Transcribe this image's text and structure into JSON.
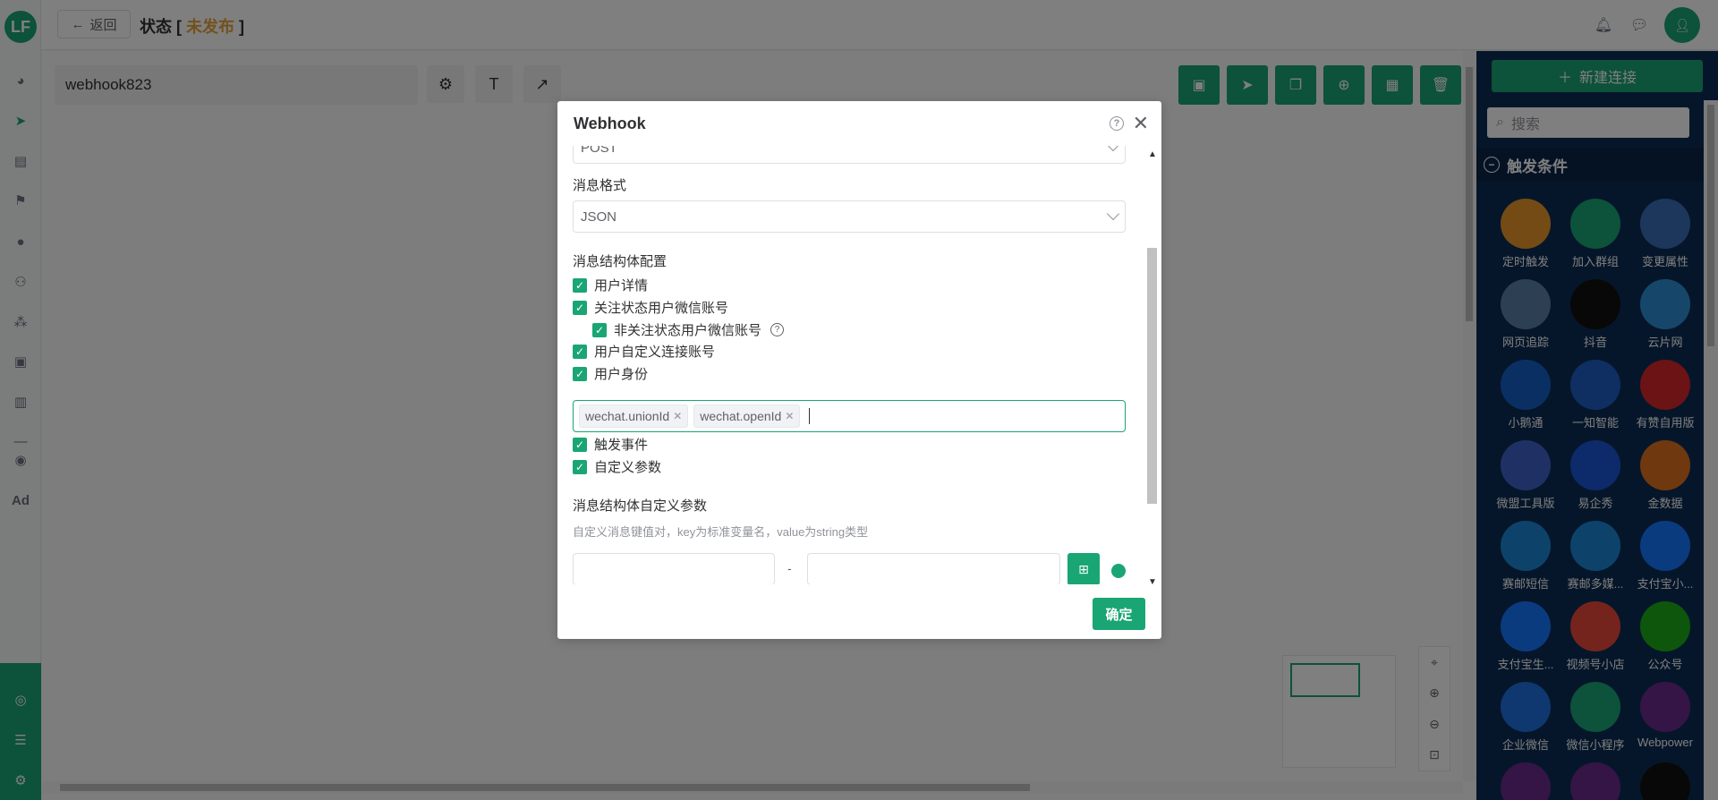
{
  "topbar": {
    "back_label": "返回",
    "status_prefix": "状态 [ ",
    "status_value": "未发布",
    "status_suffix": " ]"
  },
  "canvas": {
    "flow_name": "webhook823"
  },
  "right_panel": {
    "new_connection_label": "新建连接",
    "search_placeholder": "搜索",
    "section_title": "触发条件",
    "apps": [
      {
        "label": "定时触发",
        "color": "#e8962a"
      },
      {
        "label": "加入群组",
        "color": "#1aa574"
      },
      {
        "label": "变更属性",
        "color": "#3a6fb8"
      },
      {
        "label": "网页追踪",
        "color": "#5b7fa6"
      },
      {
        "label": "抖音",
        "color": "#111111"
      },
      {
        "label": "云片网",
        "color": "#2d8fd5"
      },
      {
        "label": "小鹅通",
        "color": "#1560c7"
      },
      {
        "label": "一知智能",
        "color": "#1f5cc4"
      },
      {
        "label": "有赞自用版",
        "color": "#d7262a"
      },
      {
        "label": "微盟工具版",
        "color": "#3e63c9"
      },
      {
        "label": "易企秀",
        "color": "#1a55d6"
      },
      {
        "label": "金数据",
        "color": "#e0701e"
      },
      {
        "label": "赛邮短信",
        "color": "#1b87d6"
      },
      {
        "label": "赛邮多媒...",
        "color": "#1b87d6"
      },
      {
        "label": "支付宝小...",
        "color": "#1677ff"
      },
      {
        "label": "支付宝生...",
        "color": "#1677ff"
      },
      {
        "label": "视频号小店",
        "color": "#e8493a"
      },
      {
        "label": "公众号",
        "color": "#1aad19"
      },
      {
        "label": "企业微信",
        "color": "#1f6fe0"
      },
      {
        "label": "微信小程序",
        "color": "#1aa574"
      },
      {
        "label": "Webpower",
        "color": "#6a2b8c"
      },
      {
        "label": "",
        "color": "#6a2b8c"
      },
      {
        "label": "",
        "color": "#6a2b8c"
      },
      {
        "label": "",
        "color": "#111111"
      }
    ]
  },
  "modal": {
    "title": "Webhook",
    "method_value": "POST",
    "format_label": "消息格式",
    "format_value": "JSON",
    "struct_label": "消息结构体配置",
    "checkboxes": {
      "user_detail": "用户详情",
      "follow_wechat": "关注状态用户微信账号",
      "unfollow_wechat": "非关注状态用户微信账号",
      "custom_account": "用户自定义连接账号",
      "user_identity": "用户身份",
      "trigger_event": "触发事件",
      "custom_params": "自定义参数"
    },
    "tags": [
      "wechat.unionId",
      "wechat.openId"
    ],
    "custom_params_label": "消息结构体自定义参数",
    "custom_params_hint": "自定义消息键值对，key为标准变量名，value为string类型",
    "kv_separator": "-",
    "confirm_label": "确定"
  }
}
